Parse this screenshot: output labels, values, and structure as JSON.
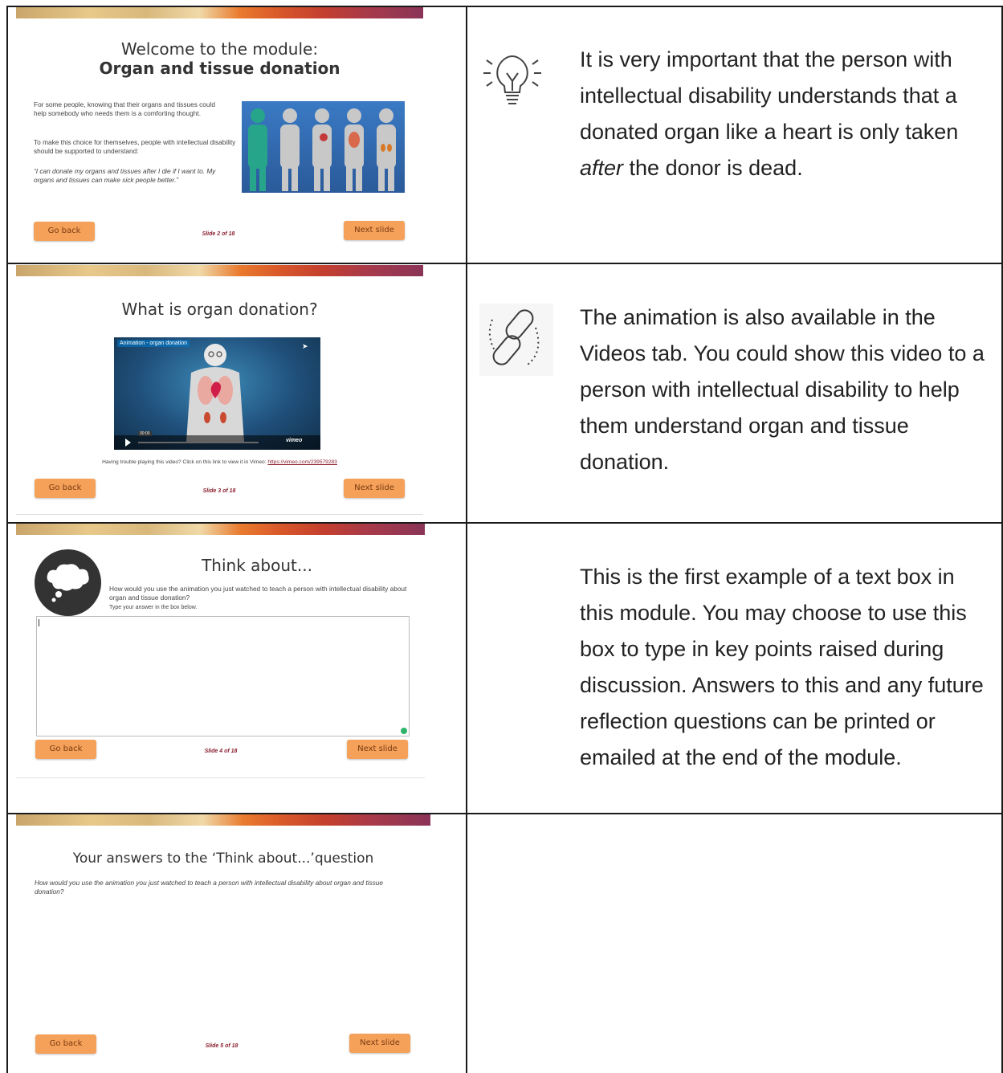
{
  "rows": [
    {
      "slide": {
        "title_line1": "Welcome to the module:",
        "title_line2": "Organ and tissue donation",
        "para1": "For some people, knowing that their organs and tissues could help somebody who needs them is a comforting thought.",
        "para2": "To make this choice for themselves, people with intellectual disability should be supported to understand:",
        "quote": "“I can donate my organs and tissues after I die if I want to. My organs and tissues can make sick people better.”",
        "back_label": "Go back",
        "next_label": "Next slide",
        "slide_number": "Slide 2 of 18"
      },
      "icon": "lightbulb-icon",
      "text_before": "It is very important that the person with intellectual disability understands that a donated organ like a heart is only taken ",
      "text_italic": "after",
      "text_after": " the donor is dead."
    },
    {
      "slide": {
        "title": "What is organ donation?",
        "video_title": "Animation - organ donation",
        "video_time": "00:00",
        "video_brand": "vimeo",
        "trouble_text": "Having trouble playing this video? Click on this link to view it in Vimeo: ",
        "trouble_link": "https://vimeo.com/239579283",
        "back_label": "Go back",
        "next_label": "Next slide",
        "slide_number": "Slide 3 of 18"
      },
      "icon": "link-icon",
      "text": "The animation is also available in the Videos tab. You could show this video to a person with intellectual disability to help them understand organ and tissue donation."
    },
    {
      "slide": {
        "title": "Think about...",
        "question": "How would you use the animation you just watched to teach a person with intellectual disability about organ and tissue donation?",
        "instruction": "Type your answer in the box below.",
        "back_label": "Go back",
        "next_label": "Next slide",
        "slide_number": "Slide 4 of 18"
      },
      "text": "This is the first example of a text box in this module. You may choose to use this box to type in key points raised during discussion. Answers to this and any future reflection questions can be printed or emailed at the end of the module."
    },
    {
      "slide": {
        "title": "Your answers to the ‘Think about...’question",
        "question": "How would you use the animation you just watched to teach a person with intellectual disability about organ and tissue donation?",
        "back_label": "Go back",
        "next_label": "Next slide",
        "slide_number": "Slide 5 of 18"
      }
    }
  ]
}
